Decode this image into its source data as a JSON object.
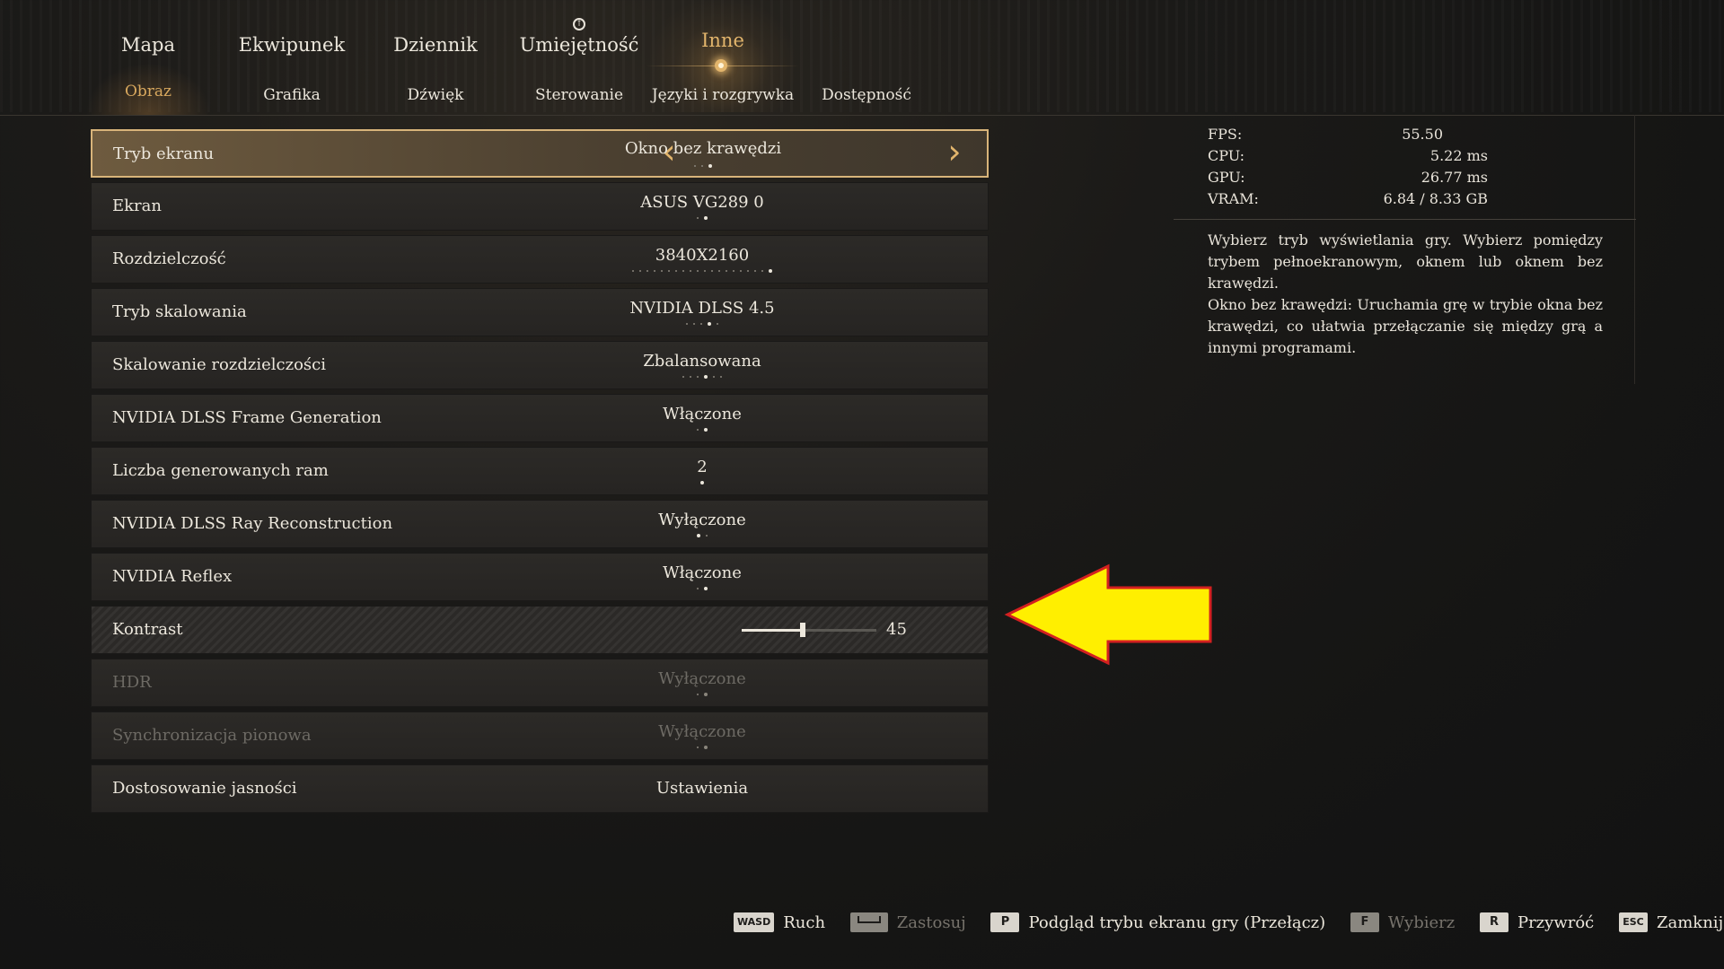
{
  "nav": {
    "tabs": [
      {
        "label": "Mapa"
      },
      {
        "label": "Ekwipunek"
      },
      {
        "label": "Dziennik"
      },
      {
        "label": "Umiejętność"
      },
      {
        "label": "Inne",
        "active": true
      }
    ],
    "subtabs": [
      {
        "label": "Obraz",
        "active": true
      },
      {
        "label": "Grafika"
      },
      {
        "label": "Dźwięk"
      },
      {
        "label": "Sterowanie"
      },
      {
        "label": "Języki i rozgrywka"
      },
      {
        "label": "Dostępność"
      }
    ]
  },
  "settings": [
    {
      "label": "Tryb ekranu",
      "value": "Okno bez krawędzi",
      "options": 3,
      "selected_index": 2
    },
    {
      "label": "Ekran",
      "value": "ASUS VG289 0",
      "options": 2,
      "selected_index": 1
    },
    {
      "label": "Rozdzielczość",
      "value": "3840X2160",
      "options": 20,
      "selected_index": 19
    },
    {
      "label": "Tryb skalowania",
      "value": "NVIDIA DLSS 4.5",
      "options": 5,
      "selected_index": 3
    },
    {
      "label": "Skalowanie rozdzielczości",
      "value": "Zbalansowana",
      "options": 6,
      "selected_index": 3
    },
    {
      "label": "NVIDIA DLSS Frame Generation",
      "value": "Włączone",
      "options": 2,
      "selected_index": 1
    },
    {
      "label": "Liczba generowanych ram",
      "value": "2",
      "options": 1,
      "selected_index": 0
    },
    {
      "label": "NVIDIA DLSS Ray Reconstruction",
      "value": "Wyłączone",
      "options": 2,
      "selected_index": 0
    },
    {
      "label": "NVIDIA Reflex",
      "value": "Włączone",
      "options": 2,
      "selected_index": 1
    },
    {
      "label": "Kontrast",
      "value": "45",
      "slider_fraction": 0.45
    },
    {
      "label": "HDR",
      "value": "Wyłączone",
      "options": 2,
      "selected_index": 1,
      "disabled": true
    },
    {
      "label": "Synchronizacja pionowa",
      "value": "Wyłączone",
      "options": 2,
      "selected_index": 1,
      "disabled": true
    },
    {
      "label": "Dostosowanie jasności",
      "value": "Ustawienia"
    }
  ],
  "stats": [
    {
      "name": "FPS:",
      "value": "55.50"
    },
    {
      "name": "CPU:",
      "value": "5.22  ms"
    },
    {
      "name": "GPU:",
      "value": "26.77  ms"
    },
    {
      "name": "VRAM:",
      "value": "6.84  /  8.33  GB"
    }
  ],
  "description": [
    "Wybierz tryb wyświetlania gry. Wybierz pomiędzy trybem pełnoekranowym, oknem lub oknem bez krawędzi.",
    "Okno bez krawędzi: Uruchamia grę w trybie okna bez krawędzi, co ułatwia przełączanie się między grą a innymi programami."
  ],
  "footer": [
    {
      "key": "WASD",
      "label": "Ruch"
    },
    {
      "key": "space",
      "label": "Zastosuj",
      "dim": true
    },
    {
      "key": "P",
      "label": "Podgląd trybu ekranu gry (Przełącz)"
    },
    {
      "key": "F",
      "label": "Wybierz",
      "dim": true
    },
    {
      "key": "R",
      "label": "Przywróć"
    },
    {
      "key": "ESC",
      "label": "Zamknij"
    }
  ],
  "colors": {
    "accent": "#e2b56c",
    "annotation_arrow": "#ffef00",
    "annotation_outline": "#d32020"
  }
}
